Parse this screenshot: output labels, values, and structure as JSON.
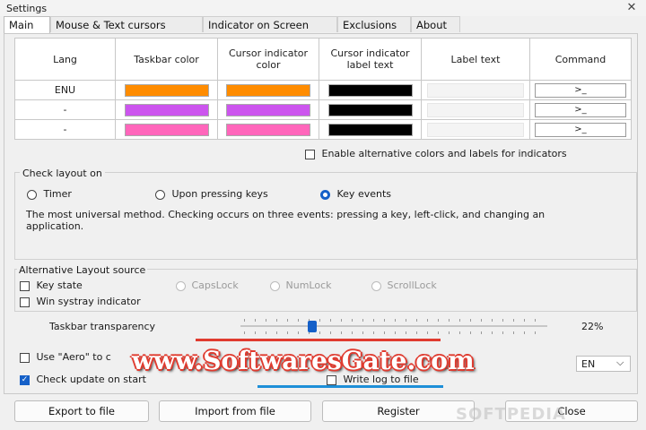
{
  "window": {
    "title": "Settings",
    "close_glyph": "✕"
  },
  "tabs": [
    "Main",
    "Mouse & Text cursors",
    "Indicator on Screen",
    "Exclusions",
    "About"
  ],
  "table": {
    "headers": [
      "Lang",
      "Taskbar color",
      "Cursor indicator color",
      "Cursor indicator label text",
      "Label text",
      "Command"
    ],
    "rows": [
      {
        "lang": "ENU",
        "taskbar_color": "#ff8c00",
        "cursor_color": "#ff8c00",
        "label_color": "#000000",
        "label_text": "",
        "command": ">_"
      },
      {
        "lang": "-",
        "taskbar_color": "#cc55ee",
        "cursor_color": "#cc55ee",
        "label_color": "#000000",
        "label_text": "",
        "command": ">_"
      },
      {
        "lang": "-",
        "taskbar_color": "#ff66bb",
        "cursor_color": "#ff66bb",
        "label_color": "#000000",
        "label_text": "",
        "command": ">_"
      }
    ]
  },
  "enable_alt": {
    "label": "Enable alternative colors and labels for indicators",
    "checked": false
  },
  "check_layout": {
    "title": "Check layout on",
    "options": [
      "Timer",
      "Upon pressing keys",
      "Key events"
    ],
    "selected": 2,
    "description": "The most universal method. Checking occurs on three events: pressing a key, left-click, and changing an application."
  },
  "alt_layout": {
    "title": "Alternative Layout source",
    "key_state": "Key state",
    "locks": [
      "CapsLock",
      "NumLock",
      "ScrollLock"
    ],
    "systray": "Win systray indicator"
  },
  "transparency": {
    "label": "Taskbar transparency",
    "value_text": "22%",
    "value": 0.22
  },
  "aero": {
    "label": "Use \"Aero\" to c",
    "checked": false
  },
  "check_update": {
    "label": "Check update on start",
    "checked": true
  },
  "write_log": {
    "label": "Write log to file",
    "checked": false
  },
  "language_select": {
    "value": "EN",
    "arrow": "⌵"
  },
  "buttons": {
    "export": "Export to file",
    "import": "Import from file",
    "register": "Register",
    "close": "Close"
  },
  "watermark": {
    "text": "www.SoftwaresGate.com",
    "brand": "SOFTPEDIA"
  }
}
